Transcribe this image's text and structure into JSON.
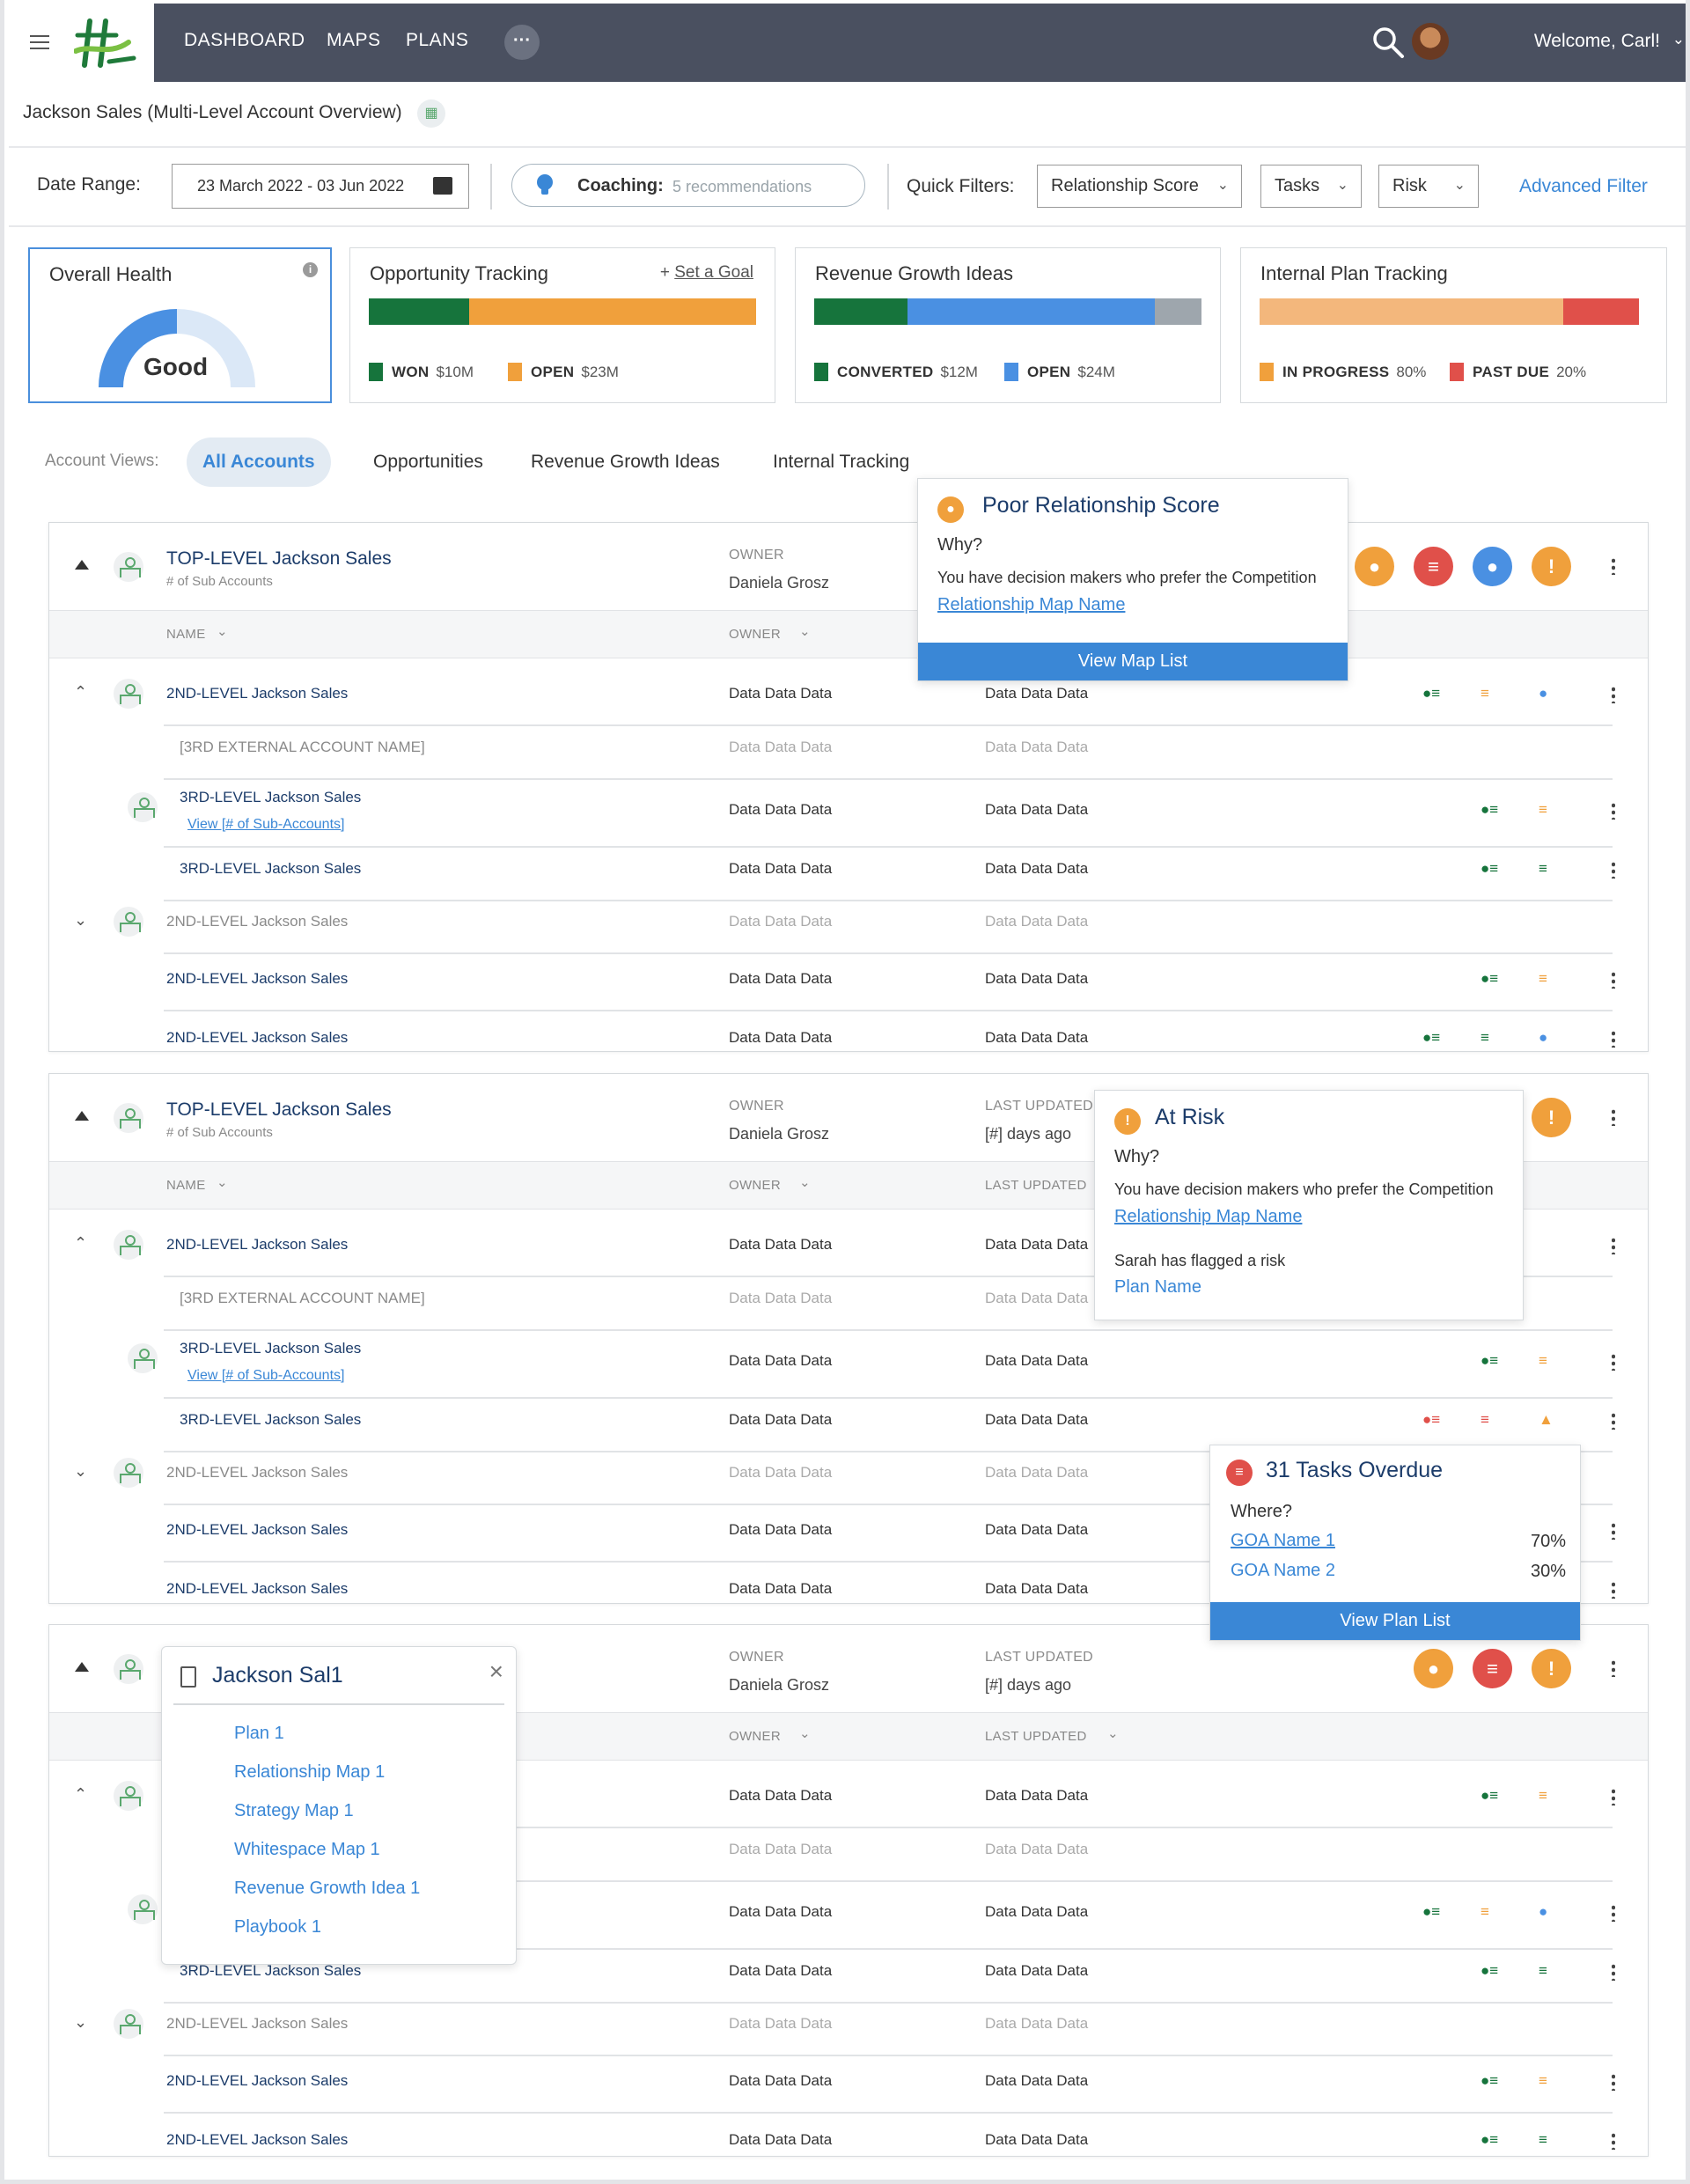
{
  "nav": {
    "links": [
      "DASHBOARD",
      "MAPS",
      "PLANS"
    ],
    "more": "···",
    "welcome": "Welcome, Carl!"
  },
  "page_title": "Jackson Sales (Multi-Level Account Overview)",
  "filters": {
    "date_label": "Date Range:",
    "date_value": "23 March 2022 - 03 Jun 2022",
    "coaching_label": "Coaching:",
    "coaching_value": "5 recommendations",
    "quick_label": "Quick Filters:",
    "relationship": "Relationship Score",
    "tasks": "Tasks",
    "risk": "Risk",
    "advanced": "Advanced Filter"
  },
  "cards": {
    "health": {
      "title": "Overall Health",
      "value": "Good",
      "level": 0.5
    },
    "opportunity": {
      "title": "Opportunity Tracking",
      "action": "+ ",
      "action_link": "Set a Goal",
      "won_label": "WON",
      "won_value": "$10M",
      "open_label": "OPEN",
      "open_value": "$23M",
      "won_share": 0.26
    },
    "revenue": {
      "title": "Revenue Growth Ideas",
      "conv_label": "CONVERTED",
      "conv_value": "$12M",
      "open_label": "OPEN",
      "open_value": "$24M",
      "conv_share": 0.24,
      "open_share": 0.64
    },
    "internal": {
      "title": "Internal Plan Tracking",
      "prog_label": "IN PROGRESS",
      "prog_value": "80%",
      "due_label": "PAST DUE",
      "due_value": "20%"
    }
  },
  "views": {
    "label": "Account Views:",
    "tabs": [
      "All Accounts",
      "Opportunities",
      "Revenue Growth Ideas",
      "Internal Tracking"
    ]
  },
  "colors": {
    "green": "#16743c",
    "orange": "#f0a03c",
    "blue": "#4a90e2",
    "gray": "#9ea6ad",
    "peach": "#f3b77c",
    "red": "#e0504a",
    "nav": "#4a5060",
    "link": "#3a87d6"
  },
  "section": {
    "title": "TOP-LEVEL Jackson Sales",
    "sub": "# of Sub Accounts",
    "owner_label": "OWNER",
    "owner": "Daniela Grosz",
    "updated_label": "LAST UPDATED",
    "updated": "[#] days ago",
    "col_name": "NAME",
    "col_owner": "OWNER",
    "col_updated": "LAST UPDATED"
  },
  "rows": {
    "second": "2ND-LEVEL Jackson Sales",
    "external": "[3RD EXTERNAL ACCOUNT NAME]",
    "third": "3RD-LEVEL Jackson Sales",
    "view_sub": "View [# of Sub-Accounts]",
    "data": "Data Data Data"
  },
  "popovers": {
    "relationship": {
      "title": "Poor Relationship Score",
      "why": "Why?",
      "text": "You have decision makers who prefer the Competition",
      "link": "Relationship Map Name",
      "button": "View Map List"
    },
    "risk": {
      "title": "At Risk",
      "why": "Why?",
      "text": "You have decision makers who prefer the Competition",
      "link": "Relationship Map Name",
      "text2": "Sarah has flagged a risk",
      "link2": "Plan Name"
    },
    "tasks": {
      "title": "31 Tasks Overdue",
      "where": "Where?",
      "goa1": "GOA Name 1",
      "goa1_pct": "70%",
      "goa2": "GOA Name 2",
      "goa2_pct": "30%",
      "button": "View Plan List"
    },
    "account_menu": {
      "title": "Jackson Sal1",
      "close": "×",
      "items": [
        "Plan 1",
        "Relationship Map 1",
        "Strategy Map 1",
        "Whitespace Map 1",
        "Revenue Growth Idea 1",
        "Playbook 1"
      ]
    }
  }
}
